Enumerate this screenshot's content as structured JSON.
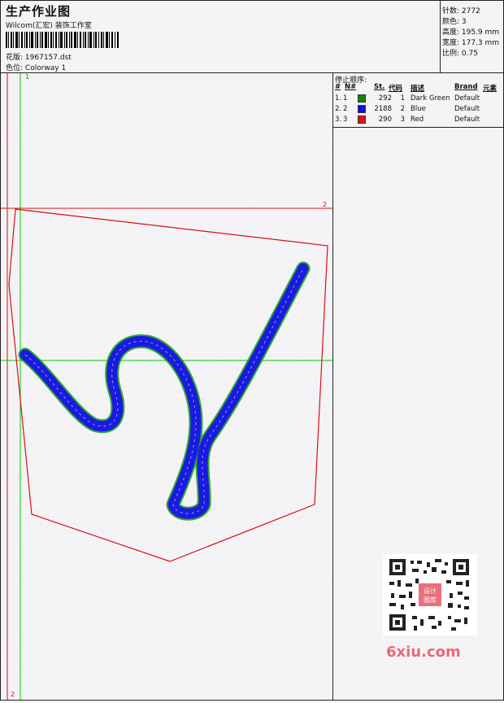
{
  "header": {
    "title": "生产作业图",
    "company": "Wilcom(汇宏) 装饰工作室",
    "design_label": "花版:",
    "design_value": "1967157.dst",
    "colorway_label": "色位:",
    "colorway_value": "Colorway 1"
  },
  "stats": {
    "stitches": "针数: 2772",
    "colors": "颜色: 3",
    "height": "高度: 195.9 mm",
    "width": "宽度: 177.3 mm",
    "scale": "比例: 0.75"
  },
  "legend": {
    "title": "停止顺序:",
    "headers": {
      "num": "#",
      "no": "N#",
      "st": "St.",
      "code": "代码",
      "desc": "描述",
      "brand": "Brand",
      "element": "元素"
    },
    "rows": [
      {
        "num": "1.",
        "no": "1",
        "color": "#0a8a0a",
        "st": "292",
        "code": "1",
        "desc": "Dark Green",
        "brand": "Default"
      },
      {
        "num": "2.",
        "no": "2",
        "color": "#1010e0",
        "st": "2188",
        "code": "2",
        "desc": "Blue",
        "brand": "Default"
      },
      {
        "num": "3.",
        "no": "3",
        "color": "#e01010",
        "st": "290",
        "code": "3",
        "desc": "Red",
        "brand": "Default"
      }
    ]
  },
  "design": {
    "marker_v_top": "1",
    "marker_v_bottom": "2",
    "marker_h": "2"
  },
  "colors": {
    "outline": "#d81010",
    "guide": "#00cc00",
    "stitch_blue": "#1a1ae0",
    "stitch_green": "#19a019"
  },
  "watermark": {
    "qr_text": "设计图库",
    "site": "6xiu.com"
  }
}
